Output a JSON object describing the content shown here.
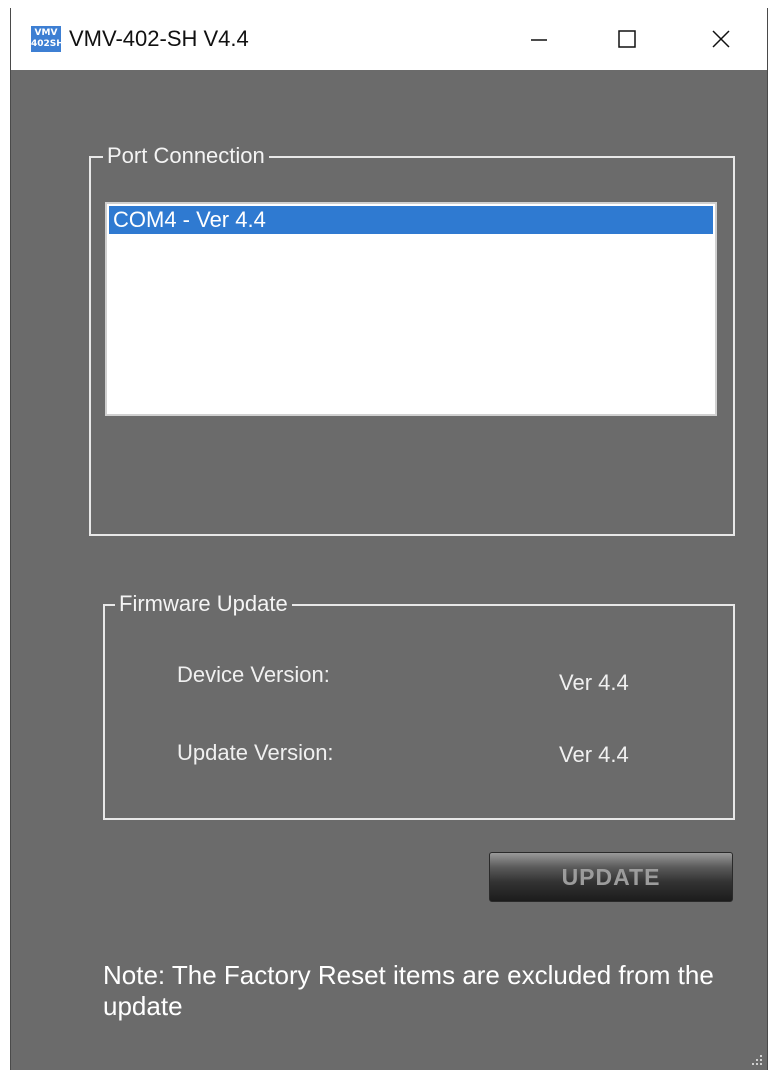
{
  "window": {
    "title": "VMV-402-SH V4.4",
    "icon_text": "VMV 402SH"
  },
  "title_controls": {
    "minimize_icon": "minimize-icon",
    "maximize_icon": "maximize-icon",
    "close_icon": "close-icon"
  },
  "port_connection": {
    "legend": "Port Connection",
    "items": [
      {
        "label": "COM4 - Ver 4.4",
        "selected": true
      }
    ]
  },
  "firmware_update": {
    "legend": "Firmware Update",
    "device_version_label": "Device Version:",
    "device_version_value": "Ver 4.4",
    "update_version_label": "Update Version:",
    "update_version_value": "Ver 4.4"
  },
  "update_button": {
    "label": "UPDATE"
  },
  "note": "Note: The Factory Reset items are excluded from the update",
  "colors": {
    "background": "#6b6b6b",
    "selection": "#2f7ad1",
    "text": "#ffffff"
  }
}
